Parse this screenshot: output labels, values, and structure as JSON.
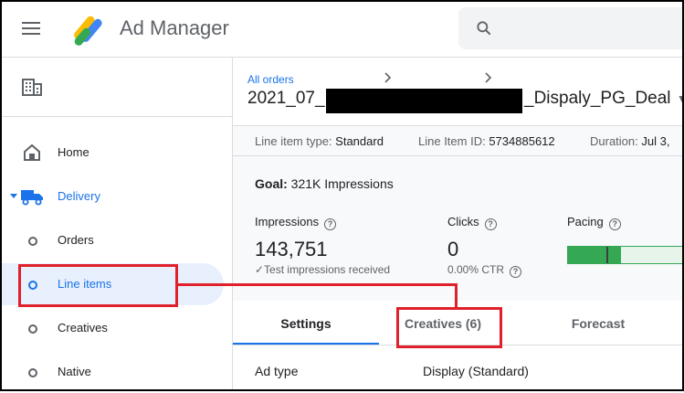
{
  "header": {
    "app_title": "Ad Manager",
    "menu_icon": "hamburger-menu-icon",
    "search_icon": "search-icon"
  },
  "sidebar": {
    "network_icon": "building-icon",
    "items": [
      {
        "label": "Home",
        "icon": "home-icon"
      },
      {
        "label": "Delivery",
        "icon": "truck-icon",
        "expanded": true
      },
      {
        "label": "Orders",
        "icon": "circle-icon"
      },
      {
        "label": "Line items",
        "icon": "circle-icon",
        "selected": true
      },
      {
        "label": "Creatives",
        "icon": "circle-icon"
      },
      {
        "label": "Native",
        "icon": "circle-icon"
      }
    ]
  },
  "breadcrumb": {
    "all_orders": "All orders"
  },
  "order": {
    "title_prefix": "2021_07_",
    "title_suffix": "_Dispaly_PG_Deal"
  },
  "meta": {
    "line_item_type_label": "Line item type:",
    "line_item_type_value": "Standard",
    "line_item_id_label": "Line Item ID:",
    "line_item_id_value": "5734885612",
    "duration_label": "Duration:",
    "duration_value": "Jul 3,"
  },
  "stats": {
    "goal_label": "Goal:",
    "goal_value": "321K Impressions",
    "impressions_label": "Impressions",
    "impressions_value": "143,751",
    "impressions_note": "✓Test impressions received",
    "clicks_label": "Clicks",
    "clicks_value": "0",
    "ctr": "0.00% CTR",
    "pacing_label": "Pacing",
    "pacing_fill_percent": 42
  },
  "tabs": [
    {
      "label": "Settings",
      "active": true
    },
    {
      "label": "Creatives (6)",
      "active": false
    },
    {
      "label": "Forecast",
      "active": false
    }
  ],
  "settings": {
    "ad_type_label": "Ad type",
    "ad_type_value": "Display (Standard)"
  },
  "colors": {
    "accent": "#1a73e8",
    "highlight": "#e0202a",
    "pacing": "#34a853"
  }
}
